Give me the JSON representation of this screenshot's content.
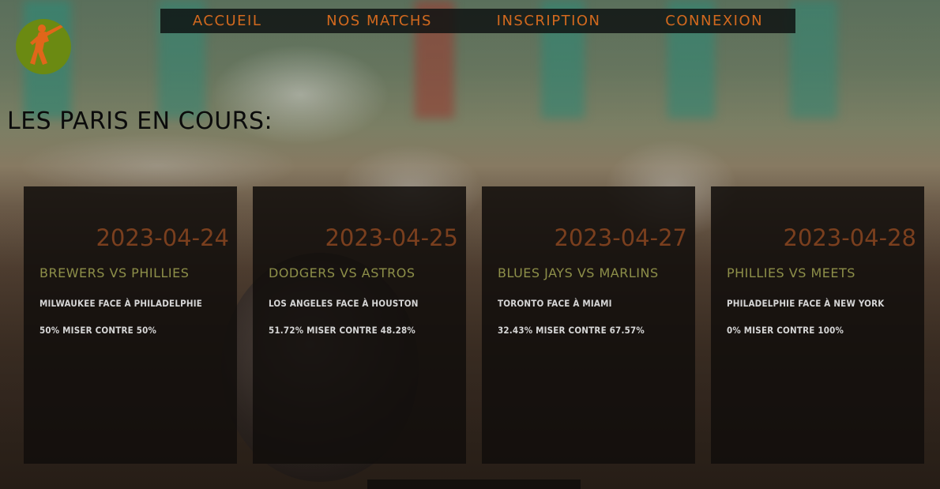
{
  "nav": {
    "items": [
      "ACCUEIL",
      "NOS MATCHS",
      "INSCRIPTION",
      "CONNEXION"
    ]
  },
  "page": {
    "title": "LES PARIS EN COURS:"
  },
  "cards": [
    {
      "date": "2023-04-24",
      "teams": "BREWERS VS PHILLIES",
      "description": "MILWAUKEE FACE À PHILADELPHIE",
      "odds": "50% MISER CONTRE 50%"
    },
    {
      "date": "2023-04-25",
      "teams": "DODGERS VS ASTROS",
      "description": "LOS ANGELES FACE À HOUSTON",
      "odds": "51.72% MISER CONTRE 48.28%"
    },
    {
      "date": "2023-04-27",
      "teams": "BLUES JAYS VS MARLINS",
      "description": "TORONTO FACE À MIAMI",
      "odds": "32.43% MISER CONTRE 67.57%"
    },
    {
      "date": "2023-04-28",
      "teams": "PHILLIES VS MEETS",
      "description": "PHILADELPHIE FACE À NEW YORK",
      "odds": "0% MISER CONTRE 100%"
    }
  ],
  "colors": {
    "accent": "#d2691e",
    "logo_bg": "#6b8a12",
    "teams_text": "#8d8f49",
    "date_text": "#7a3f1e"
  },
  "icons": {
    "logo": "baseball-batter-icon"
  }
}
